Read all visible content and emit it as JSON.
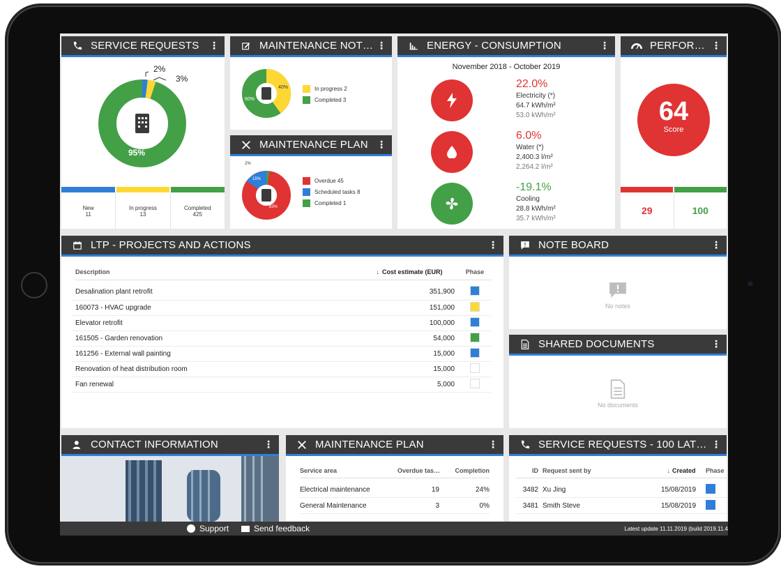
{
  "colors": {
    "header_bg": "#3a3a3a",
    "accent_blue": "#2f7fd8",
    "red": "#e03333",
    "green": "#43a047",
    "yellow": "#fdd835",
    "blue": "#2f7fd8"
  },
  "service_requests": {
    "title": "SERVICE REQUESTS",
    "pct_blue": "2%",
    "pct_yellow": "3%",
    "pct_green": "95%",
    "stats": [
      {
        "label": "New",
        "value": "11"
      },
      {
        "label": "In progress",
        "value": "13"
      },
      {
        "label": "Completed",
        "value": "425"
      }
    ]
  },
  "maintenance_notices": {
    "title": "MAINTENANCE NOT…",
    "pct_yellow": "40%",
    "pct_green": "60%",
    "legend": [
      {
        "label": "In progress",
        "count": "2"
      },
      {
        "label": "Completed",
        "count": "3"
      }
    ]
  },
  "maintenance_plan_chart": {
    "title": "MAINTENANCE PLAN",
    "pct_green": "2%",
    "pct_blue": "15%",
    "pct_red": "83%",
    "legend": [
      {
        "label": "Overdue",
        "count": "45"
      },
      {
        "label": "Scheduled tasks",
        "count": "8"
      },
      {
        "label": "Completed",
        "count": "1"
      }
    ]
  },
  "energy": {
    "title": "ENERGY - CONSUMPTION",
    "period": "November 2018 - October 2019",
    "items": [
      {
        "pct": "22.0%",
        "name": "Electricity (*)",
        "current": "64.7 kWh/m²",
        "previous": "53.0 kWh/m²",
        "icon": "bolt-icon"
      },
      {
        "pct": "6.0%",
        "name": "Water (*)",
        "current": "2,400.3 l/m²",
        "previous": "2,264.2 l/m²",
        "icon": "drop-icon"
      },
      {
        "pct": "-19.1%",
        "name": "Cooling",
        "current": "28.8 kWh/m²",
        "previous": "35.7 kWh/m²",
        "icon": "fan-icon"
      }
    ]
  },
  "performance": {
    "title": "PERFOR…",
    "score": "64",
    "score_label": "Score",
    "left_value": "29",
    "right_value": "100"
  },
  "ltp": {
    "title": "LTP - PROJECTS AND ACTIONS",
    "columns": {
      "description": "Description",
      "cost": "Cost estimate (EUR)",
      "phase": "Phase"
    },
    "rows": [
      {
        "description": "Desalination plant retrofit",
        "cost": "351,900",
        "phase_color": "#2f7fd8"
      },
      {
        "description": "160073 - HVAC upgrade",
        "cost": "151,000",
        "phase_color": "#fdd835"
      },
      {
        "description": "Elevator retrofit",
        "cost": "100,000",
        "phase_color": "#2f7fd8"
      },
      {
        "description": "161505 - Garden renovation",
        "cost": "54,000",
        "phase_color": "#43a047"
      },
      {
        "description": "161256 - External wall painting",
        "cost": "15,000",
        "phase_color": "#2f7fd8"
      },
      {
        "description": "Renovation of heat distribution room",
        "cost": "15,000",
        "phase_color": "#ffffff"
      },
      {
        "description": "Fan renewal",
        "cost": "5,000",
        "phase_color": "#ffffff"
      }
    ]
  },
  "note_board": {
    "title": "NOTE BOARD",
    "empty": "No notes"
  },
  "shared_documents": {
    "title": "SHARED DOCUMENTS",
    "empty": "No documents"
  },
  "contact": {
    "title": "CONTACT INFORMATION"
  },
  "maintenance_plan_table": {
    "title": "MAINTENANCE PLAN",
    "columns": {
      "area": "Service area",
      "overdue": "Overdue tas…",
      "completion": "Completion"
    },
    "rows": [
      {
        "area": "Electrical maintenance",
        "overdue": "19",
        "completion": "24%"
      },
      {
        "area": "General Maintenance",
        "overdue": "3",
        "completion": "0%"
      }
    ]
  },
  "service_requests_latest": {
    "title": "SERVICE REQUESTS - 100 LAT…",
    "columns": {
      "id": "ID",
      "sent_by": "Request sent by",
      "created": "Created",
      "phase": "Phase"
    },
    "rows": [
      {
        "id": "3482",
        "sent_by": "Xu Jing",
        "created": "15/08/2019",
        "phase_color": "#2f7fd8"
      },
      {
        "id": "3481",
        "sent_by": "Smith Steve",
        "created": "15/08/2019",
        "phase_color": "#2f7fd8"
      }
    ]
  },
  "footer": {
    "support": "Support",
    "feedback": "Send feedback",
    "update": "Latest update 11.11.2019 (build 2019.11.4"
  }
}
